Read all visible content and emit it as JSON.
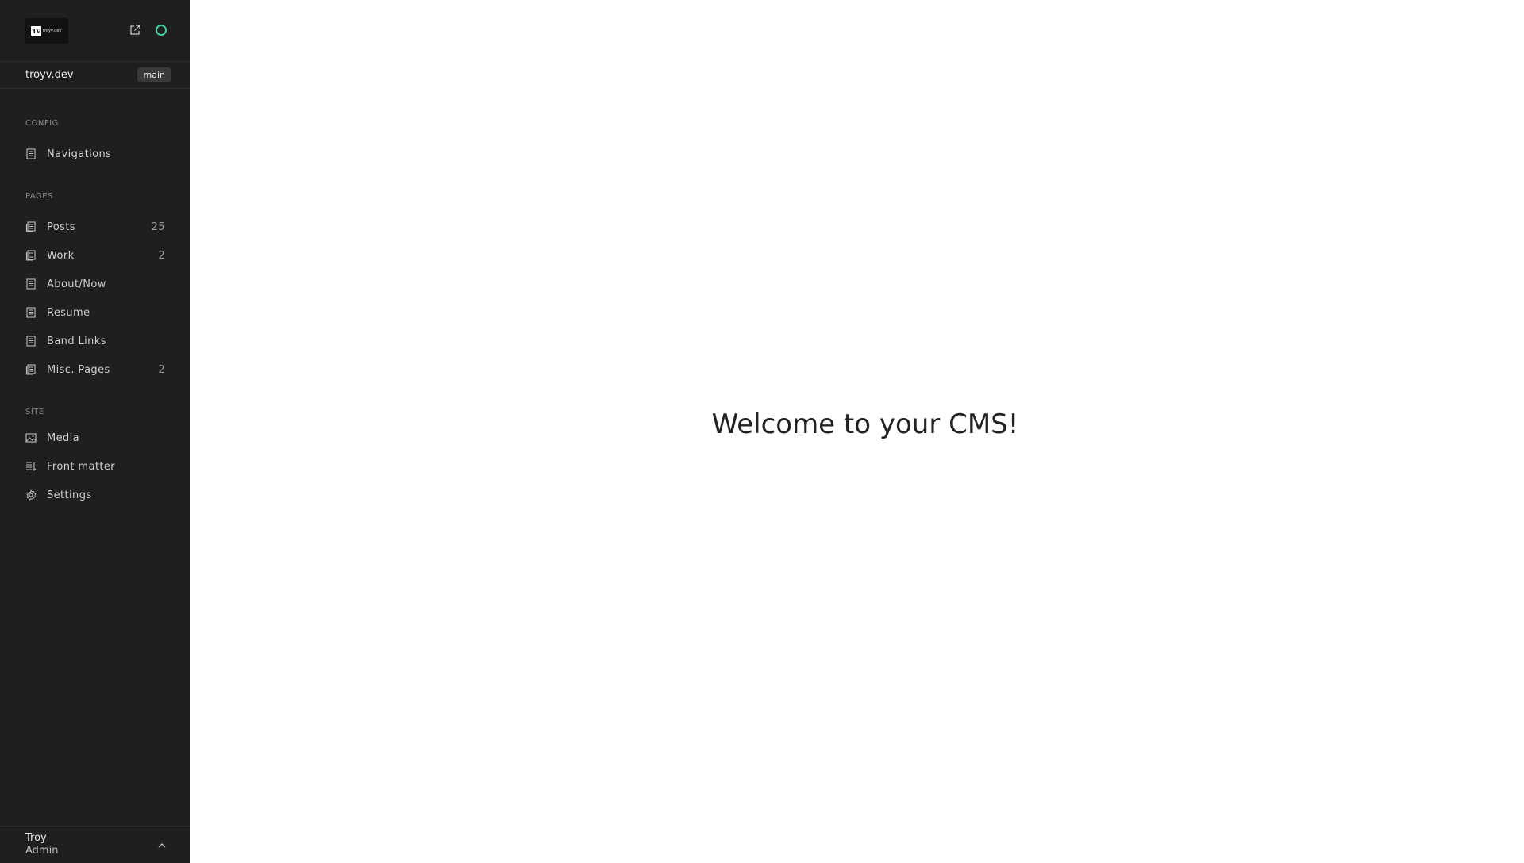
{
  "logo": {
    "mark": "Tv",
    "text": "troyv.dev"
  },
  "repo": {
    "name": "troyv.dev",
    "branch": "main"
  },
  "sections": {
    "config": {
      "label": "CONFIG",
      "items": [
        {
          "label": "Navigations",
          "icon": "document-icon"
        }
      ]
    },
    "pages": {
      "label": "PAGES",
      "items": [
        {
          "label": "Posts",
          "count": "25",
          "icon": "documents-icon"
        },
        {
          "label": "Work",
          "count": "2",
          "icon": "documents-icon"
        },
        {
          "label": "About/Now",
          "count": "",
          "icon": "document-icon"
        },
        {
          "label": "Resume",
          "count": "",
          "icon": "document-icon"
        },
        {
          "label": "Band Links",
          "count": "",
          "icon": "document-icon"
        },
        {
          "label": "Misc. Pages",
          "count": "2",
          "icon": "documents-icon"
        }
      ]
    },
    "site": {
      "label": "SITE",
      "items": [
        {
          "label": "Media",
          "icon": "image-icon"
        },
        {
          "label": "Front matter",
          "icon": "sliders-icon"
        },
        {
          "label": "Settings",
          "icon": "gear-icon"
        }
      ]
    }
  },
  "user": {
    "name": "Troy",
    "role": "Admin"
  },
  "main": {
    "welcome": "Welcome to your CMS!"
  },
  "colors": {
    "sidebar_bg": "#1f1f1f",
    "status_accent": "#3fd1a3"
  }
}
